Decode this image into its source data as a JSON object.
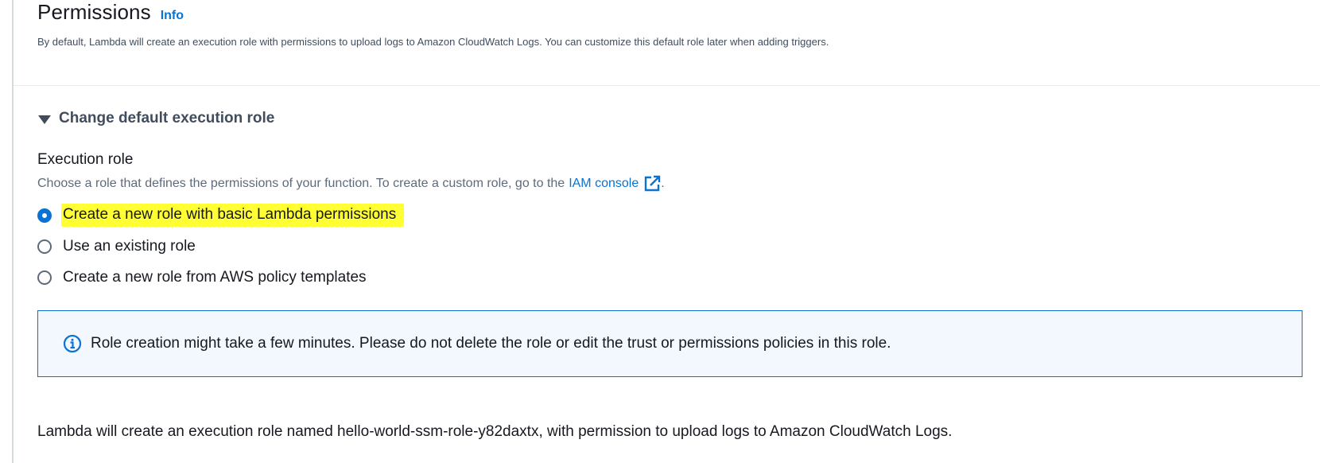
{
  "section": {
    "title": "Permissions",
    "info_link": "Info",
    "description": "By default, Lambda will create an execution role with permissions to upload logs to Amazon CloudWatch Logs. You can customize this default role later when adding triggers."
  },
  "expander": {
    "label": "Change default execution role",
    "expanded": true,
    "icon": "caret-down-icon"
  },
  "execution_role": {
    "label": "Execution role",
    "description_prefix": "Choose a role that defines the permissions of your function. To create a custom role, go to the",
    "link_text": "IAM console",
    "link_icon": "external-link-icon",
    "description_suffix": ".",
    "options": [
      {
        "label": "Create a new role with basic Lambda permissions",
        "selected": true,
        "highlighted": true
      },
      {
        "label": "Use an existing role",
        "selected": false,
        "highlighted": false
      },
      {
        "label": "Create a new role from AWS policy templates",
        "selected": false,
        "highlighted": false
      }
    ]
  },
  "alert": {
    "icon": "info-circle-icon",
    "text": "Role creation might take a few minutes. Please do not delete the role or edit the trust or permissions policies in this role."
  },
  "footer": {
    "text": "Lambda will create an execution role named hello-world-ssm-role-y82daxtx, with permission to upload logs to Amazon CloudWatch Logs."
  },
  "colors": {
    "link": "#0972d3",
    "highlight": "#ffff33",
    "alert_bg": "#f2f8fd",
    "alert_border": "#0972d3"
  }
}
